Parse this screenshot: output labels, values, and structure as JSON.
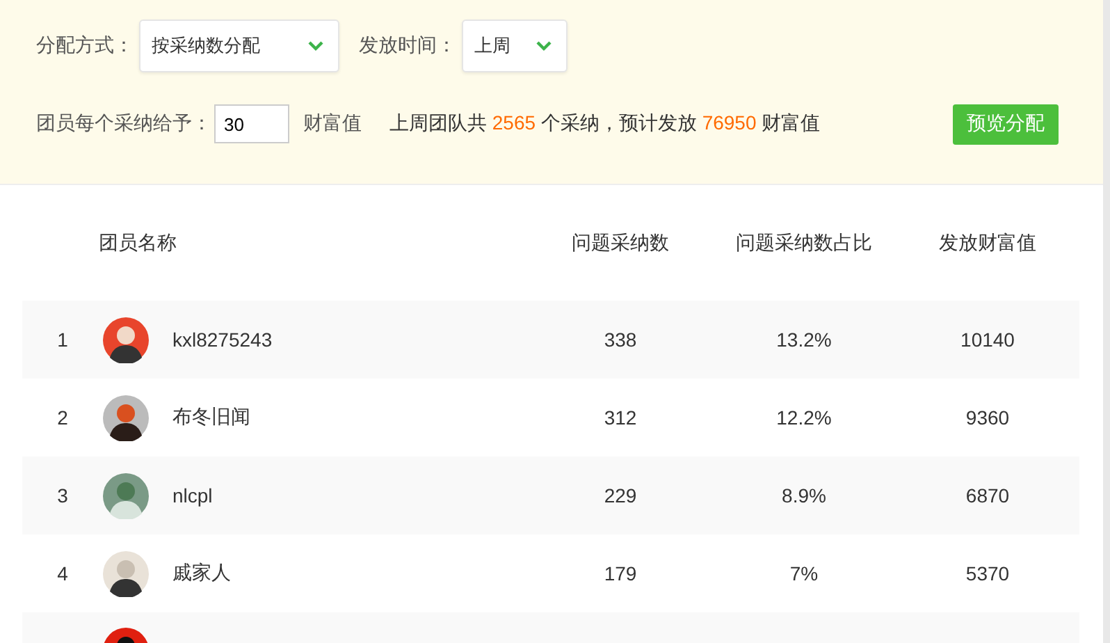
{
  "filters": {
    "method_label": "分配方式：",
    "method_value": "按采纳数分配",
    "time_label": "发放时间：",
    "time_value": "上周"
  },
  "reward": {
    "label": "团员每个采纳给予：",
    "value": "30",
    "unit": "财富值",
    "summary_1": "上周团队共",
    "adopted": "2565",
    "summary_2": "个采纳，预计发放",
    "total": "76950",
    "summary_3": "财富值",
    "button": "预览分配"
  },
  "table": {
    "columns": [
      "团员名称",
      "问题采纳数",
      "问题采纳数占比",
      "发放财富值"
    ],
    "rows": [
      {
        "kind": "member",
        "rank": "1",
        "name": "kxl8275243",
        "count": "338",
        "ratio": "13.2%",
        "wealth": "10140"
      },
      {
        "kind": "member",
        "rank": "2",
        "name": "布冬旧闻",
        "count": "312",
        "ratio": "12.2%",
        "wealth": "9360"
      },
      {
        "kind": "member",
        "rank": "3",
        "name": "nlcpl",
        "count": "229",
        "ratio": "8.9%",
        "wealth": "6870"
      },
      {
        "kind": "member",
        "rank": "4",
        "name": "戚家人",
        "count": "179",
        "ratio": "7%",
        "wealth": "5370"
      },
      {
        "kind": "partial"
      }
    ]
  }
}
